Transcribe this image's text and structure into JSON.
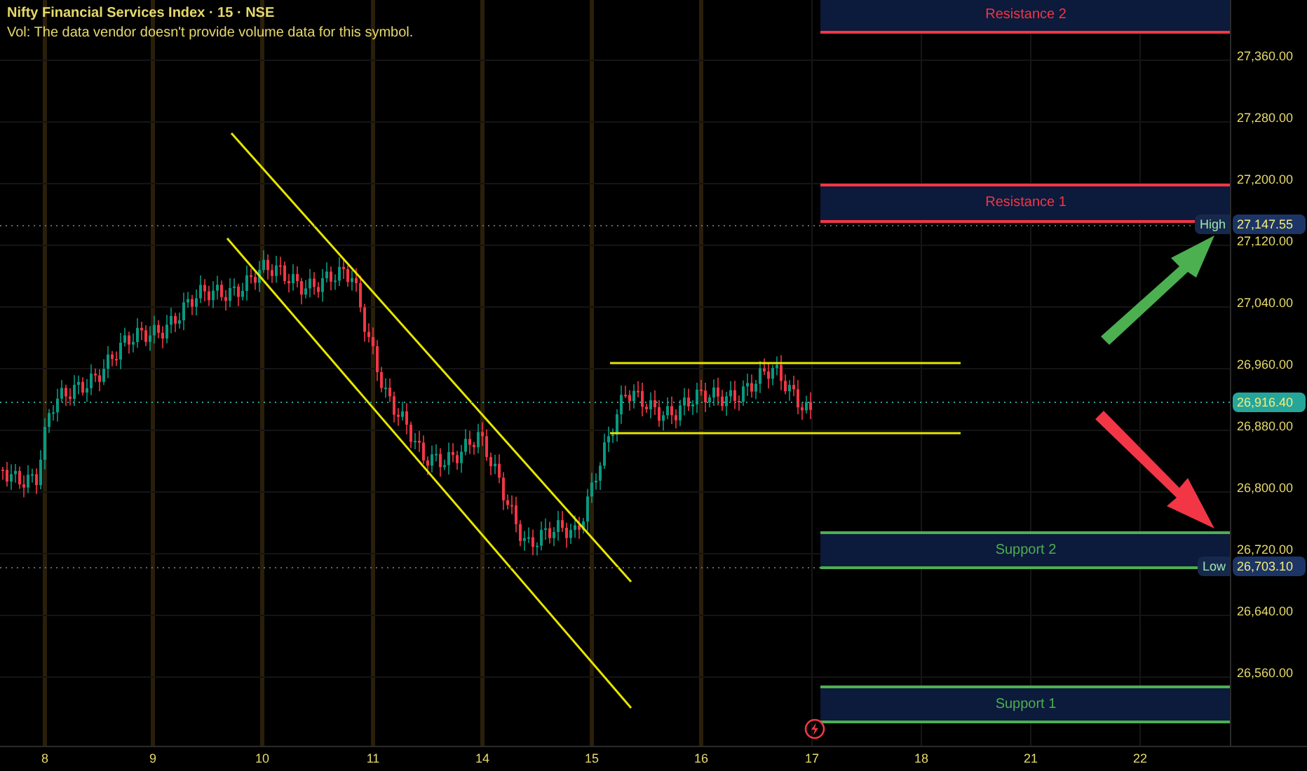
{
  "legend": {
    "title": "Nifty Financial Services Index · 15 · NSE",
    "note": "Vol: The data vendor doesn't provide volume data for this symbol."
  },
  "zones": [
    {
      "label": "Resistance 2",
      "kind": "resistance"
    },
    {
      "label": "Resistance 1",
      "kind": "resistance"
    },
    {
      "label": "Support 2",
      "kind": "support"
    },
    {
      "label": "Support 1",
      "kind": "support"
    }
  ],
  "price_axis": {
    "ticks": [
      "27,360.00",
      "27,280.00",
      "27,200.00",
      "27,120.00",
      "27,040.00",
      "26,960.00",
      "26,880.00",
      "26,800.00",
      "26,720.00",
      "26,640.00",
      "26,560.00"
    ],
    "tags": [
      {
        "kind": "high",
        "label": "High",
        "value": "27,147.55"
      },
      {
        "kind": "last",
        "value": "26,916.40"
      },
      {
        "kind": "low",
        "label": "Low",
        "value": "26,703.10"
      }
    ]
  },
  "time_axis": [
    "8",
    "9",
    "10",
    "11",
    "14",
    "15",
    "16",
    "17",
    "18",
    "21",
    "22"
  ]
}
